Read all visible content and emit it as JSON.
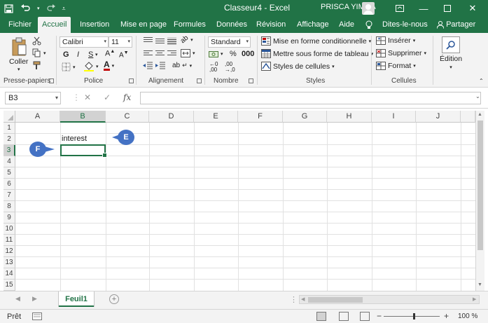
{
  "colors": {
    "brand": "#217346",
    "callout": "#4472c4",
    "ribbon_bg": "#f3f3f3",
    "selection": "#217346"
  },
  "titlebar": {
    "doc_title": "Classeur4  -  Excel",
    "user_name": "PRISCA YIMGA",
    "save_icon": "save-icon",
    "undo_icon": "undo-icon",
    "redo_icon": "redo-icon",
    "customize_icon": "customize-quick-access-icon"
  },
  "tabs": [
    {
      "label": "Fichier"
    },
    {
      "label": "Accueil",
      "active": true
    },
    {
      "label": "Insertion"
    },
    {
      "label": "Mise en page"
    },
    {
      "label": "Formules"
    },
    {
      "label": "Données"
    },
    {
      "label": "Révision"
    },
    {
      "label": "Affichage"
    },
    {
      "label": "Aide"
    },
    {
      "label": "Dites-le-nous"
    },
    {
      "label": "Partager"
    }
  ],
  "ribbon": {
    "clipboard": {
      "label": "Presse-papiers",
      "paste": "Coller"
    },
    "font": {
      "label": "Police",
      "name": "Calibri",
      "size": "11",
      "bold": "G",
      "italic": "I",
      "underline": "S"
    },
    "alignment": {
      "label": "Alignement"
    },
    "number": {
      "label": "Nombre",
      "format": "Standard"
    },
    "styles": {
      "label": "Styles",
      "conditional": "Mise en forme conditionnelle",
      "as_table": "Mettre sous forme de tableau",
      "cell_styles": "Styles de cellules"
    },
    "cells": {
      "label": "Cellules",
      "insert": "Insérer",
      "delete": "Supprimer",
      "format": "Format"
    },
    "editing": {
      "label": "Édition"
    }
  },
  "formula_bar": {
    "name_box": "B3",
    "cancel": "✕",
    "enter": "✓",
    "fx": "fx",
    "value": ""
  },
  "grid": {
    "columns": [
      "A",
      "B",
      "C",
      "D",
      "E",
      "F",
      "G",
      "H",
      "I",
      "J"
    ],
    "rows": [
      "1",
      "2",
      "3",
      "4",
      "5",
      "6",
      "7",
      "8",
      "9",
      "10",
      "11",
      "12",
      "13",
      "14",
      "15"
    ],
    "selected_column": "B",
    "selected_row": "3",
    "cells": {
      "B2": "interest"
    }
  },
  "callouts": {
    "e": "E",
    "f": "F"
  },
  "sheets": {
    "active": "Feuil1"
  },
  "status": {
    "text": "Prêt",
    "zoom": "100 %"
  }
}
